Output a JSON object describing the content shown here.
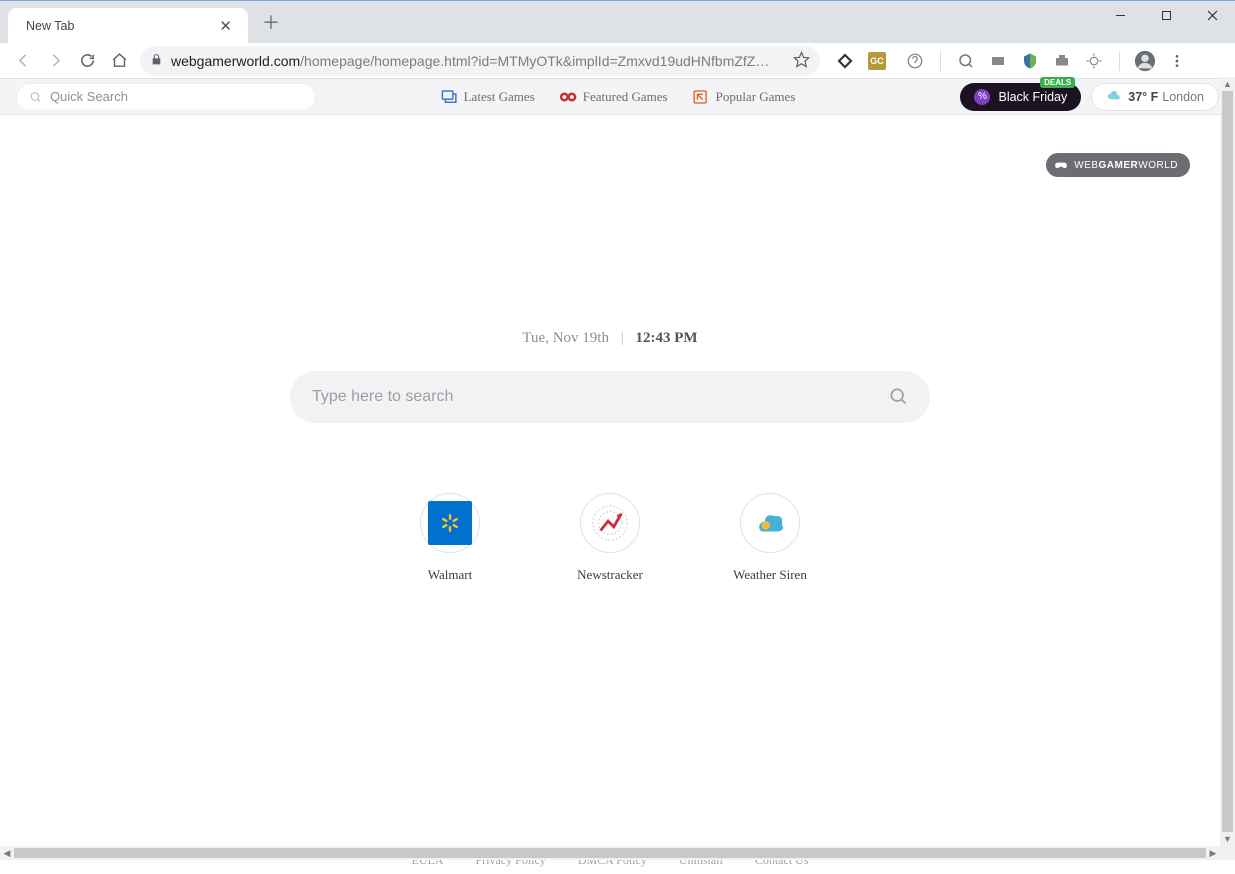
{
  "browser": {
    "tab_title": "New Tab",
    "url_domain": "webgamerworld.com",
    "url_path": "/homepage/homepage.html?id=MTMyOTk&implId=Zmxvd19udHNfbmZfZ…"
  },
  "toolbar": {
    "quick_search_placeholder": "Quick Search",
    "nav_items": [
      {
        "label": "Latest Games"
      },
      {
        "label": "Featured Games"
      },
      {
        "label": "Popular Games"
      }
    ],
    "promo": {
      "label": "Black Friday",
      "badge": "DEALS"
    },
    "weather": {
      "temp": "37° F",
      "city": "London"
    }
  },
  "brand": {
    "part1": "WEB",
    "part2": "GAMER",
    "part3": "WORLD"
  },
  "datetime": {
    "date": "Tue, Nov 19th",
    "time": "12:43 PM"
  },
  "main_search": {
    "placeholder": "Type here to search"
  },
  "quick_links": [
    {
      "label": "Walmart"
    },
    {
      "label": "Newstracker"
    },
    {
      "label": "Weather Siren"
    }
  ],
  "footer_links": [
    "EULA",
    "Privacy Policy",
    "DMCA Policy",
    "Uninstall",
    "Contact Us"
  ]
}
